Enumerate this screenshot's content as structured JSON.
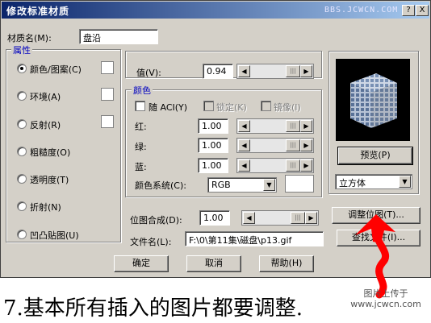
{
  "title": "修改标准材质",
  "watermark": "BBS.JCWCN.COM",
  "title_buttons": {
    "help": "?",
    "close": "X"
  },
  "material_name": {
    "label": "材质名(M):",
    "value": "盘沿"
  },
  "attributes": {
    "legend": "属性",
    "options": [
      {
        "label": "颜色/图案(C)",
        "selected": true,
        "has_swatch": true
      },
      {
        "label": "环境(A)",
        "selected": false,
        "has_swatch": true
      },
      {
        "label": "反射(R)",
        "selected": false,
        "has_swatch": true
      },
      {
        "label": "粗糙度(O)",
        "selected": false,
        "has_swatch": false
      },
      {
        "label": "透明度(T)",
        "selected": false,
        "has_swatch": false
      },
      {
        "label": "折射(N)",
        "selected": false,
        "has_swatch": false
      },
      {
        "label": "凹凸贴图(U)",
        "selected": false,
        "has_swatch": false
      }
    ]
  },
  "value_field": {
    "label": "值(V):",
    "value": "0.94"
  },
  "color": {
    "legend": "颜色",
    "aci": {
      "label": "随 ACI(Y)"
    },
    "lock": {
      "label": "锁定(K)"
    },
    "mirror": {
      "label": "镜像(I)"
    },
    "red": {
      "label": "红:",
      "value": "1.00"
    },
    "green": {
      "label": "绿:",
      "value": "1.00"
    },
    "blue": {
      "label": "蓝:",
      "value": "1.00"
    },
    "system": {
      "label": "颜色系统(C):",
      "value": "RGB"
    }
  },
  "preview_button": "预览(P)",
  "preview_shape": "立方体",
  "bitmap_blend": {
    "label": "位图合成(D):",
    "value": "1.00"
  },
  "adjust_bitmap_button": "调整位图(T)...",
  "file_name": {
    "label": "文件名(L):",
    "value": "F:\\0\\第11集\\磁盘\\p13.gif"
  },
  "find_file_button": "查找文件(I)...",
  "buttons": {
    "ok": "确定",
    "cancel": "取消",
    "help": "帮助(H)"
  },
  "caption": "7.基本所有插入的图片都要调整.",
  "stamp": {
    "line1": "图片上传于",
    "line2": "www.jcwcn.com"
  },
  "colors": {
    "title_start": "#0a246a",
    "title_end": "#a6caf0",
    "dialog_bg": "#d4d0c8",
    "legend_text": "#0000c0",
    "annotation_red": "#ff0000"
  }
}
